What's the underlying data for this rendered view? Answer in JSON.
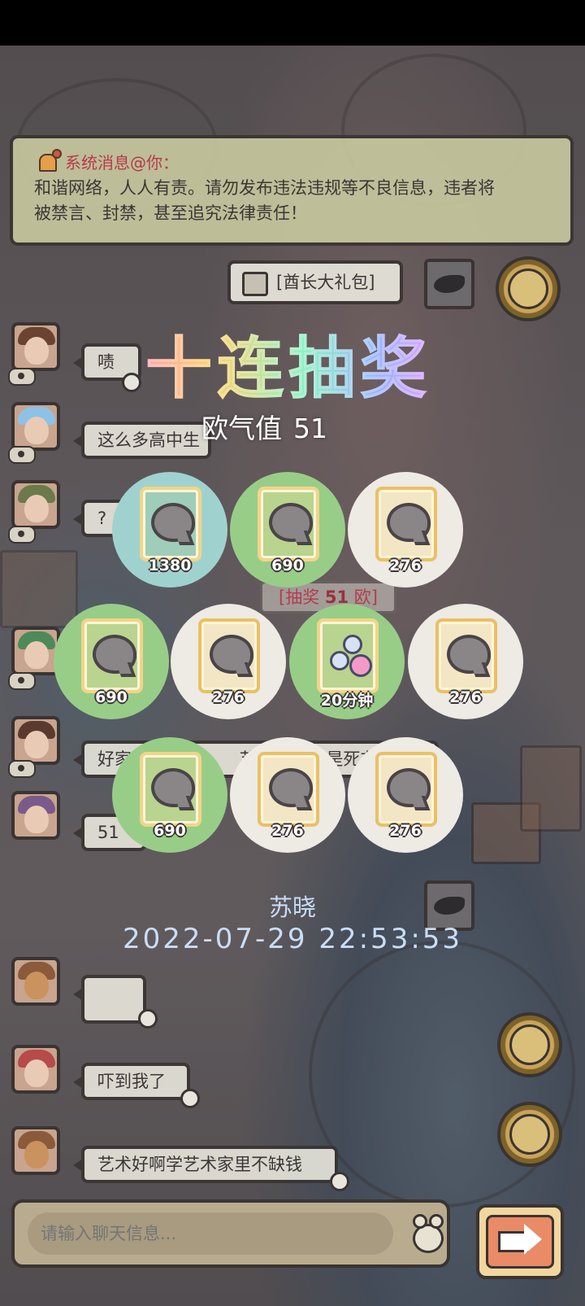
{
  "system_message": {
    "title": "系统消息@你：",
    "body_line1": "和谐网络，人人有责。请勿发布违法违规等不良信息，违者将",
    "body_line2": "被禁言、封禁，甚至追究法律责任！"
  },
  "gift_bubble": {
    "label": "[酋长大礼包]"
  },
  "chat": {
    "messages": [
      {
        "text": "啧"
      },
      {
        "text": "这么多高中生"
      },
      {
        "text": "?"
      },
      {
        "text": "好家"
      },
      {
        "text": "51"
      },
      {
        "text": "吓到我了"
      },
      {
        "text": "艺术好啊学艺术家里不缺钱"
      }
    ],
    "partial_tail": "是死在",
    "partial_mid": "艺术"
  },
  "lottery": {
    "title": "十连抽奖",
    "luck_label": "欧气值",
    "luck_value": "51",
    "lucky_tag_prefix": "[抽奖 ",
    "lucky_tag_value": "51",
    "lucky_tag_suffix": " 欧]",
    "prizes": [
      {
        "icon": "chat-bubble-icon",
        "amount": "1380",
        "rarity": "teal"
      },
      {
        "icon": "chat-bubble-icon",
        "amount": "690",
        "rarity": "green"
      },
      {
        "icon": "chat-bubble-icon",
        "amount": "276",
        "rarity": "white"
      },
      {
        "icon": "chat-bubble-icon",
        "amount": "690",
        "rarity": "green"
      },
      {
        "icon": "chat-bubble-icon",
        "amount": "276",
        "rarity": "white"
      },
      {
        "icon": "flask-icon",
        "amount": "20分钟",
        "rarity": "green"
      },
      {
        "icon": "chat-bubble-icon",
        "amount": "276",
        "rarity": "white"
      },
      {
        "icon": "chat-bubble-icon",
        "amount": "690",
        "rarity": "green"
      },
      {
        "icon": "chat-bubble-icon",
        "amount": "276",
        "rarity": "white"
      },
      {
        "icon": "chat-bubble-icon",
        "amount": "276",
        "rarity": "white"
      }
    ],
    "winner_name": "苏晓",
    "timestamp": "2022-07-29  22:53:53"
  },
  "input": {
    "placeholder": "请输入聊天信息..."
  },
  "colors": {
    "system_title": "#c0394a",
    "panel_bg": "#c6c79e",
    "teal": "#9fd2cf",
    "green": "#98cd88",
    "white": "#eeeae4",
    "timestamp": "#c9ddf7"
  }
}
